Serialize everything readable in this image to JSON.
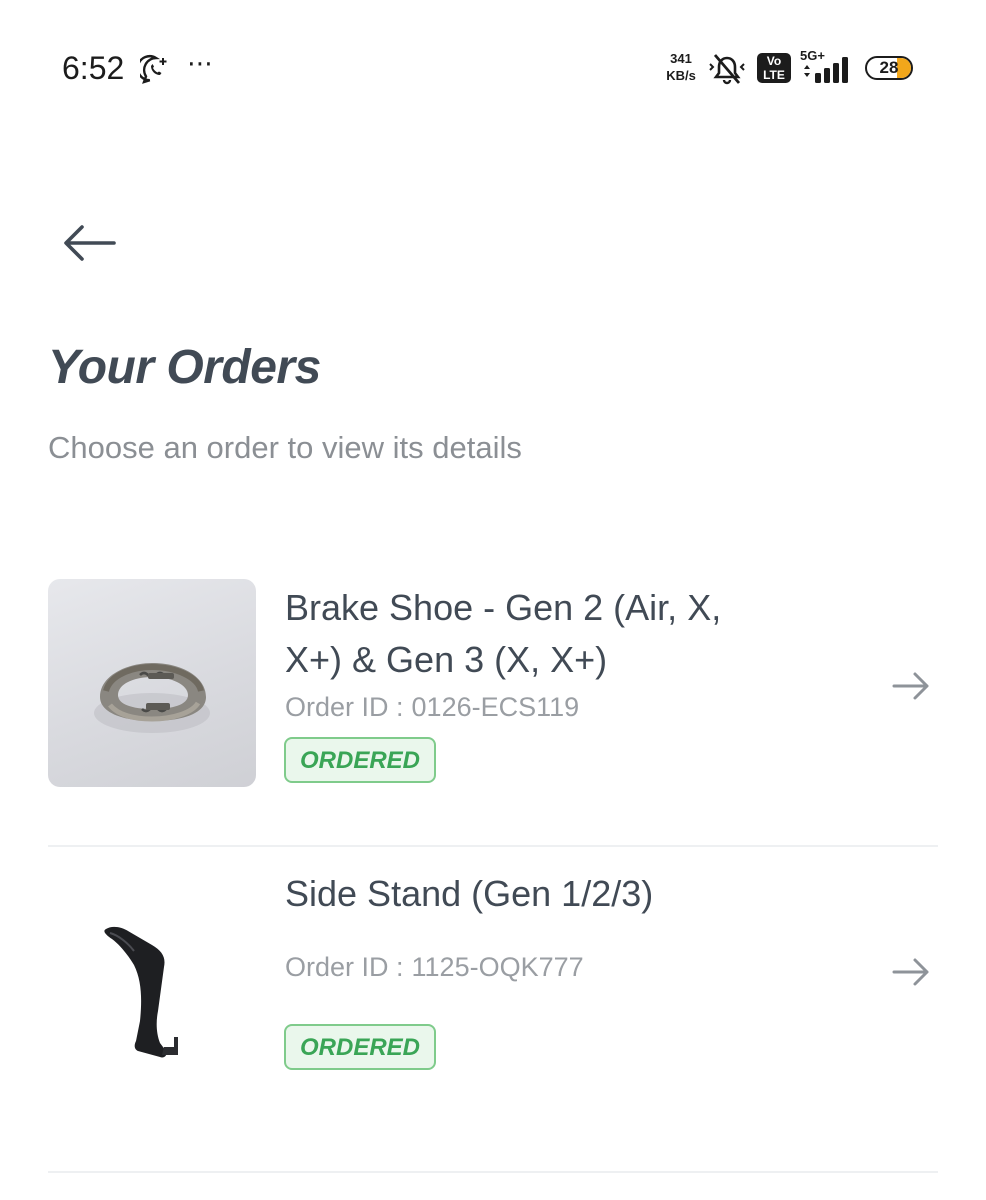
{
  "status_bar": {
    "time": "6:52",
    "net_speed_value": "341",
    "net_speed_unit": "KB/s",
    "volte_top": "Vo",
    "volte_bottom": "LTE",
    "network_type": "5G+",
    "battery_level": "28",
    "icons": [
      "whatsapp-icon",
      "more-dots-icon",
      "mute-icon",
      "signal-icon",
      "battery-icon"
    ]
  },
  "header": {
    "back_icon": "arrow-left-icon",
    "title": "Your Orders",
    "subtitle": "Choose an order to view its details"
  },
  "orders": [
    {
      "name": "Brake Shoe - Gen 2 (Air, X, X+) & Gen 3 (X, X+)",
      "id_label": "Order ID :",
      "id_value": "0126-ECS119",
      "status": "ORDERED",
      "image_icon": "brake-shoe-image",
      "action_icon": "arrow-right-icon"
    },
    {
      "name": "Side Stand (Gen 1/2/3)",
      "id_label": "Order ID :",
      "id_value": "1125-OQK777",
      "status": "ORDERED",
      "image_icon": "side-stand-image",
      "action_icon": "arrow-right-icon"
    }
  ],
  "colors": {
    "title": "#414a55",
    "subtitle": "#8b8f94",
    "status_green": "#3aa556",
    "status_bg": "#eaf7ec",
    "status_border": "#7fcb8b",
    "battery_accent": "#f2a71b"
  }
}
